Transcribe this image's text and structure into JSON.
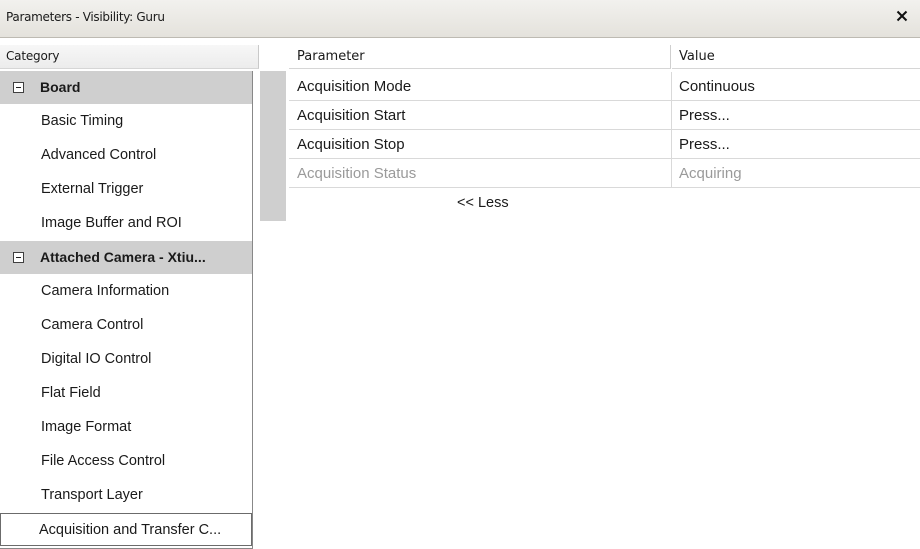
{
  "window": {
    "title": "Parameters - Visibility: Guru",
    "close_icon": "close-icon"
  },
  "headers": {
    "category": "Category",
    "parameter": "Parameter",
    "value": "Value"
  },
  "sidebar": {
    "groups": [
      {
        "label": "Board",
        "expanded": true,
        "items": [
          "Basic Timing",
          "Advanced Control",
          "External Trigger",
          "Image Buffer and ROI"
        ]
      },
      {
        "label": "Attached Camera - Xtiu...",
        "expanded": true,
        "items": [
          "Camera Information",
          "Camera Control",
          "Digital IO Control",
          "Flat Field",
          "Image Format",
          "File Access Control",
          "Transport Layer",
          "Acquisition and Transfer C..."
        ]
      }
    ],
    "selected_item": "Acquisition and Transfer C..."
  },
  "parameters": [
    {
      "name": "Acquisition Mode",
      "value": "Continuous",
      "enabled": true
    },
    {
      "name": "Acquisition Start",
      "value": "Press...",
      "enabled": true
    },
    {
      "name": "Acquisition Stop",
      "value": "Press...",
      "enabled": true
    },
    {
      "name": "Acquisition Status",
      "value": "Acquiring",
      "enabled": false
    }
  ],
  "less_link": "<< Less",
  "colors": {
    "group_bg": "#cfcfcf",
    "disabled_text": "#9a9a9a",
    "titlebar": "#ebe9e4"
  }
}
